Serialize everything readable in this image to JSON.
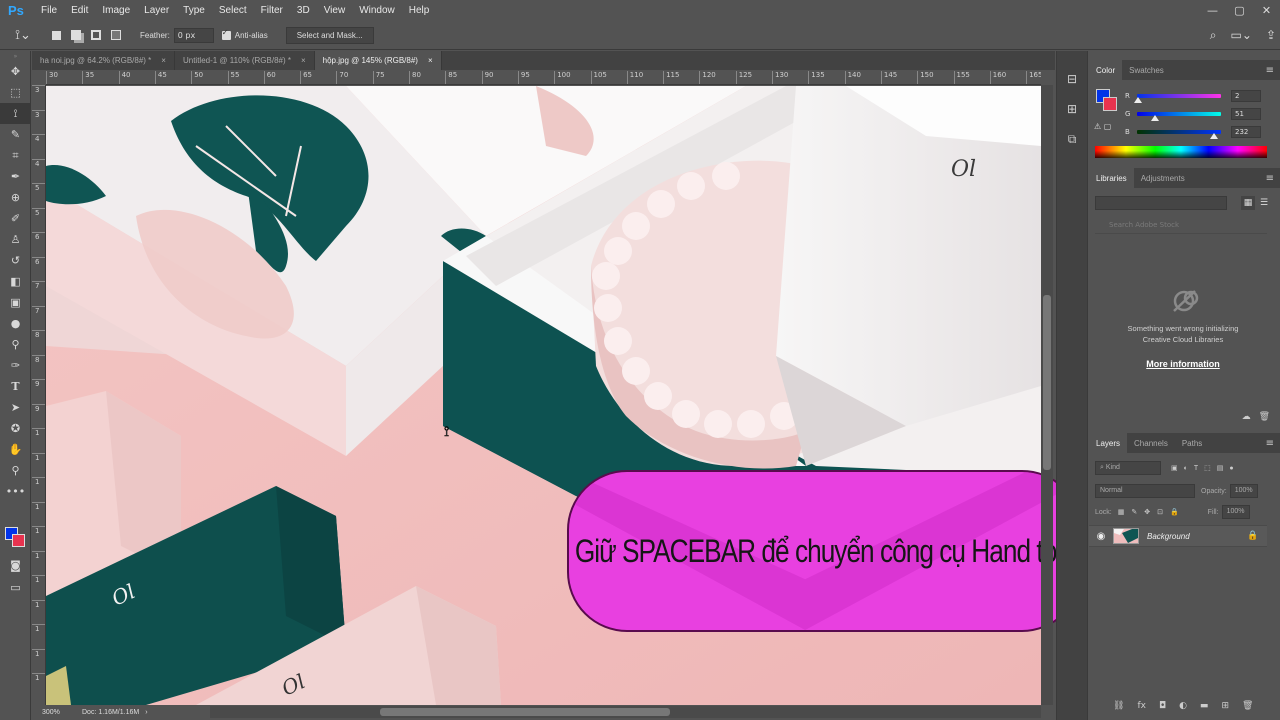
{
  "app": {
    "logo": "Ps",
    "menu": [
      "File",
      "Edit",
      "Image",
      "Layer",
      "Type",
      "Select",
      "Filter",
      "3D",
      "View",
      "Window",
      "Help"
    ],
    "window_controls": [
      "—",
      "▢",
      "✕"
    ]
  },
  "options_bar": {
    "feather_label": "Feather:",
    "feather_value": "0 px",
    "antialias_label": "Anti-alias",
    "select_mask_button": "Select and Mask..."
  },
  "doc_tabs": [
    {
      "label": "ha noi.jpg @ 64.2% (RGB/8#) *",
      "close": "×"
    },
    {
      "label": "Untitled-1 @ 110% (RGB/8#) *",
      "close": "×"
    },
    {
      "label": "hộp.jpg @ 145% (RGB/8#)",
      "close": "×"
    }
  ],
  "ruler": {
    "h_ticks": [
      "30",
      "35",
      "40",
      "45",
      "50",
      "55",
      "60",
      "65",
      "70",
      "75",
      "80",
      "85",
      "90",
      "95",
      "100",
      "105",
      "110",
      "115",
      "120",
      "125",
      "130",
      "135",
      "140",
      "145",
      "150",
      "155",
      "160",
      "165"
    ],
    "v_ticks": [
      "3",
      "3",
      "4",
      "4",
      "5",
      "5",
      "6",
      "6",
      "7",
      "7",
      "8",
      "8",
      "9",
      "9",
      "1",
      "1",
      "1",
      "1",
      "1",
      "1",
      "1",
      "1",
      "1",
      "1",
      "1"
    ]
  },
  "status": {
    "zoom": "300%",
    "doc": "Doc: 1.16M/1.16M"
  },
  "caption": {
    "text": "Giữ SPACEBAR  để chuyển công cụ Hand tool"
  },
  "color_panel": {
    "tabs": [
      "Color",
      "Swatches"
    ],
    "channels": [
      {
        "name": "R",
        "value": "2"
      },
      {
        "name": "G",
        "value": "51"
      },
      {
        "name": "B",
        "value": "232"
      }
    ],
    "foreground": "#0233e8",
    "background": "#e8334f"
  },
  "libraries_panel": {
    "tabs": [
      "Libraries",
      "Adjustments"
    ],
    "search_placeholder": "Search Adobe Stock",
    "message_line1": "Something went wrong initializing",
    "message_line2": "Creative Cloud Libraries",
    "more_info": "More information"
  },
  "layers_panel": {
    "tabs": [
      "Layers",
      "Channels",
      "Paths"
    ],
    "kind_label": "Kind",
    "blend_mode": "Normal",
    "opacity_label": "Opacity:",
    "opacity_value": "100%",
    "lock_label": "Lock:",
    "fill_label": "Fill:",
    "fill_value": "100%",
    "layers": [
      {
        "name": "Background",
        "visible": true,
        "locked": true
      }
    ]
  },
  "tools": [
    "move",
    "marquee",
    "lasso",
    "quick-select",
    "crop",
    "eyedropper",
    "spot-heal",
    "brush",
    "clone-stamp",
    "history-brush",
    "eraser",
    "gradient",
    "blur",
    "dodge",
    "pen",
    "type",
    "path-select",
    "shape",
    "hand",
    "zoom",
    "more"
  ]
}
